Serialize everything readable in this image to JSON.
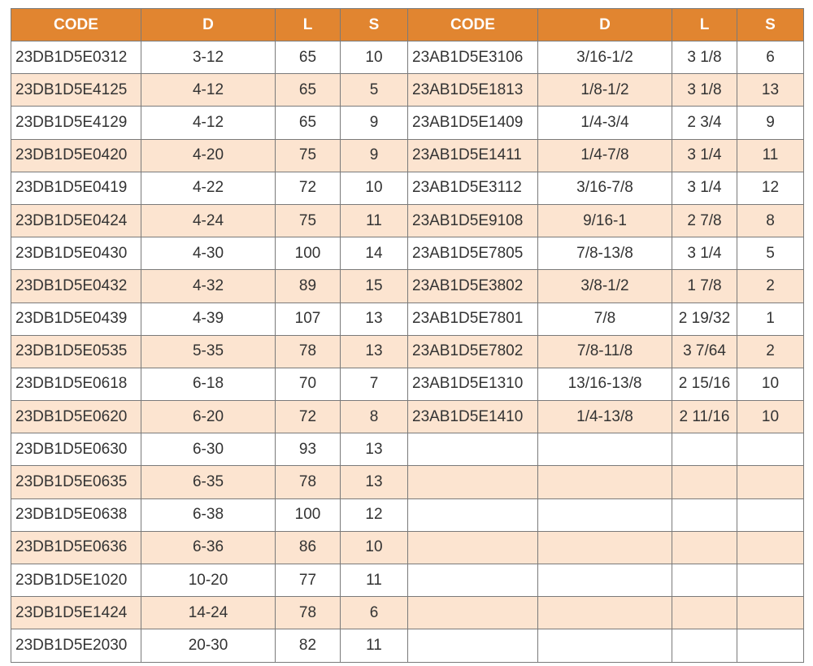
{
  "headers": [
    "CODE",
    "D",
    "L",
    "S",
    "CODE",
    "D",
    "L",
    "S"
  ],
  "rows": [
    [
      "23DB1D5E0312",
      "3-12",
      "65",
      "10",
      "23AB1D5E3106",
      "3/16-1/2",
      "3 1/8",
      "6"
    ],
    [
      "23DB1D5E4125",
      "4-12",
      "65",
      "5",
      "23AB1D5E1813",
      "1/8-1/2",
      "3 1/8",
      "13"
    ],
    [
      "23DB1D5E4129",
      "4-12",
      "65",
      "9",
      "23AB1D5E1409",
      "1/4-3/4",
      "2 3/4",
      "9"
    ],
    [
      "23DB1D5E0420",
      "4-20",
      "75",
      "9",
      "23AB1D5E1411",
      "1/4-7/8",
      "3 1/4",
      "11"
    ],
    [
      "23DB1D5E0419",
      "4-22",
      "72",
      "10",
      "23AB1D5E3112",
      "3/16-7/8",
      "3 1/4",
      "12"
    ],
    [
      "23DB1D5E0424",
      "4-24",
      "75",
      "11",
      "23AB1D5E9108",
      "9/16-1",
      "2 7/8",
      "8"
    ],
    [
      "23DB1D5E0430",
      "4-30",
      "100",
      "14",
      "23AB1D5E7805",
      "7/8-13/8",
      "3 1/4",
      "5"
    ],
    [
      "23DB1D5E0432",
      "4-32",
      "89",
      "15",
      "23AB1D5E3802",
      "3/8-1/2",
      "1 7/8",
      "2"
    ],
    [
      "23DB1D5E0439",
      "4-39",
      "107",
      "13",
      "23AB1D5E7801",
      "7/8",
      "2 19/32",
      "1"
    ],
    [
      "23DB1D5E0535",
      "5-35",
      "78",
      "13",
      "23AB1D5E7802",
      "7/8-11/8",
      "3  7/64",
      "2"
    ],
    [
      "23DB1D5E0618",
      "6-18",
      "70",
      "7",
      "23AB1D5E1310",
      "13/16-13/8",
      "2 15/16",
      "10"
    ],
    [
      "23DB1D5E0620",
      "6-20",
      "72",
      "8",
      "23AB1D5E1410",
      "1/4-13/8",
      "2 11/16",
      "10"
    ],
    [
      "23DB1D5E0630",
      "6-30",
      "93",
      "13",
      "",
      "",
      "",
      ""
    ],
    [
      "23DB1D5E0635",
      "6-35",
      "78",
      "13",
      "",
      "",
      "",
      ""
    ],
    [
      "23DB1D5E0638",
      "6-38",
      "100",
      "12",
      "",
      "",
      "",
      ""
    ],
    [
      "23DB1D5E0636",
      "6-36",
      "86",
      "10",
      "",
      "",
      "",
      ""
    ],
    [
      "23DB1D5E1020",
      "10-20",
      "77",
      "11",
      "",
      "",
      "",
      ""
    ],
    [
      "23DB1D5E1424",
      "14-24",
      "78",
      "6",
      "",
      "",
      "",
      ""
    ],
    [
      "23DB1D5E2030",
      "20-30",
      "82",
      "11",
      "",
      "",
      "",
      ""
    ]
  ],
  "colors": {
    "header_bg": "#e18530",
    "header_text": "#ffffff",
    "row_alt_bg": "#fce4d0",
    "row_bg": "#ffffff",
    "border": "#7a7a7a",
    "text": "#333333"
  }
}
